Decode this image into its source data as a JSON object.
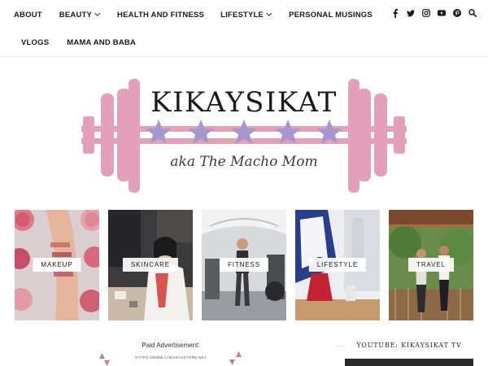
{
  "nav": {
    "row1": [
      {
        "label": "ABOUT",
        "dropdown": false
      },
      {
        "label": "BEAUTY",
        "dropdown": true
      },
      {
        "label": "HEALTH AND FITNESS",
        "dropdown": false
      },
      {
        "label": "LIFESTYLE",
        "dropdown": true
      },
      {
        "label": "PERSONAL MUSINGS",
        "dropdown": false
      }
    ],
    "row2": [
      {
        "label": "VLOGS"
      },
      {
        "label": "MAMA AND BABA"
      }
    ],
    "social_icons": [
      "facebook-icon",
      "twitter-icon",
      "instagram-icon",
      "youtube-icon",
      "pinterest-icon",
      "search-icon"
    ]
  },
  "logo": {
    "title": "KIKAYSIKAT",
    "tagline": "aka The Macho Mom",
    "colors": {
      "barbell": "#e3a0b8",
      "stars": "#a797cf",
      "text": "#1b1b1b",
      "tagline": "#3a3a3a"
    }
  },
  "categories": [
    {
      "label": "MAKEUP"
    },
    {
      "label": "SKINCARE"
    },
    {
      "label": "FITNESS"
    },
    {
      "label": "LIFESTYLE"
    },
    {
      "label": "TRAVEL"
    }
  ],
  "ad": {
    "title": "Paid Advertisement:",
    "url": "HTTPS://WWW.CHESKASSTORE.NET"
  },
  "youtube": {
    "title": "YOUTUBE: KIKAYSIKAT TV"
  }
}
